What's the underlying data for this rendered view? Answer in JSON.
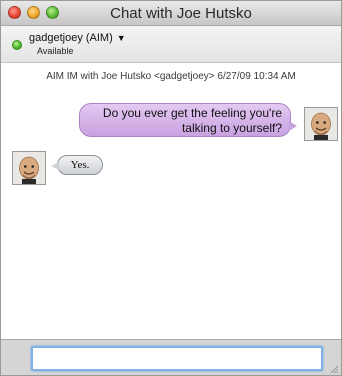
{
  "window": {
    "title": "Chat with Joe Hutsko"
  },
  "header": {
    "account": "gadgetjoey (AIM)",
    "status": "Available"
  },
  "transcript": {
    "meta": "AIM IM with Joe Hutsko <gadgetjoey> 6/27/09 10:34 AM",
    "messages": [
      {
        "from": "self",
        "text": "Do you ever get the feeling you're talking to yourself?"
      },
      {
        "from": "other",
        "text": "Yes."
      }
    ]
  },
  "composer": {
    "value": ""
  },
  "icons": {
    "close": "close-button",
    "minimize": "minimize-button",
    "zoom": "zoom-button",
    "status": "available-status-icon",
    "dropdown": "chevron-down-icon",
    "smiley": "smiley-icon",
    "resize": "resize-grip-icon"
  },
  "colors": {
    "outgoing_bubble": "#d6b3ea",
    "incoming_bubble": "#dcdfe4",
    "focus_ring": "#7fb0e6",
    "available": "#48b42a"
  }
}
